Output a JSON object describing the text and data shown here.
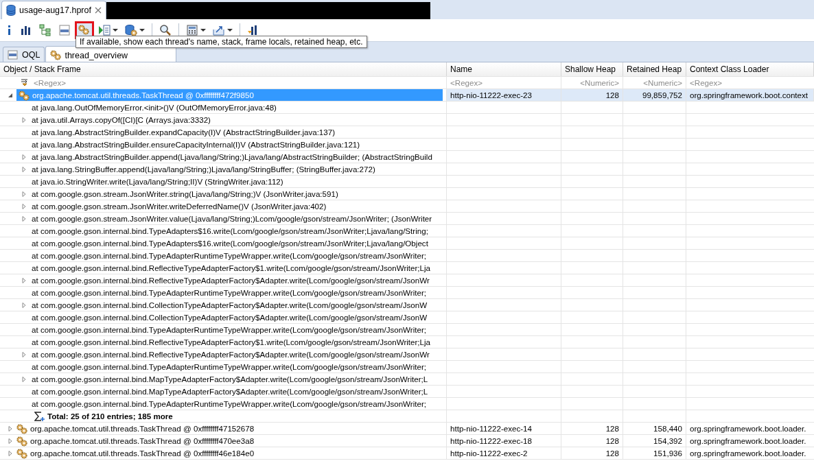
{
  "editor_tab": {
    "title": "usage-aug17.hprof",
    "selected": true
  },
  "toolbar": [
    {
      "pressed": false,
      "dropdown": false
    },
    {
      "pressed": false,
      "dropdown": false
    },
    {
      "pressed": false,
      "dropdown": false
    },
    {
      "pressed": false,
      "dropdown": false
    },
    {
      "pressed": true,
      "dropdown": false
    },
    {
      "pressed": false,
      "dropdown": true
    },
    {
      "pressed": false,
      "dropdown": true
    },
    {
      "pressed": false,
      "dropdown": false
    },
    {
      "pressed": false,
      "dropdown": true
    },
    {
      "pressed": false,
      "dropdown": true
    },
    {
      "pressed": false,
      "dropdown": false
    }
  ],
  "tooltip": "If available, show each thread's name, stack, frame locals, retained heap, etc.",
  "tabs": [
    {
      "label": "OQL",
      "selected": false
    },
    {
      "label": "thread_overview",
      "selected": true
    }
  ],
  "table": {
    "columns": [
      "Object / Stack Frame",
      "Name",
      "Shallow Heap",
      "Retained Heap",
      "Context Class Loader"
    ],
    "filters": [
      "<Regex>",
      "<Regex>",
      "<Numeric>",
      "<Numeric>",
      "<Regex>"
    ],
    "rows": [
      {
        "object": "org.apache.tomcat.util.threads.TaskThread @ 0xffffffff472f9850",
        "name": "http-nio-11222-exec-23",
        "shallow_heap": "128",
        "retained_heap": "99,859,752",
        "class_loader": "org.springframework.boot.context",
        "expanded": true,
        "selected": true,
        "children": [
          {
            "kind": "frame",
            "text": "at java.lang.OutOfMemoryError.<init>()V (OutOfMemoryError.java:48)",
            "expandable": false
          },
          {
            "kind": "frame",
            "text": "at java.util.Arrays.copyOf([CI)[C (Arrays.java:3332)",
            "expandable": true
          },
          {
            "kind": "frame",
            "text": "at java.lang.AbstractStringBuilder.expandCapacity(I)V (AbstractStringBuilder.java:137)",
            "expandable": false
          },
          {
            "kind": "frame",
            "text": "at java.lang.AbstractStringBuilder.ensureCapacityInternal(I)V (AbstractStringBuilder.java:121)",
            "expandable": false
          },
          {
            "kind": "frame",
            "text": "at java.lang.AbstractStringBuilder.append(Ljava/lang/String;)Ljava/lang/AbstractStringBuilder; (AbstractStringBuild",
            "expandable": true
          },
          {
            "kind": "frame",
            "text": "at java.lang.StringBuffer.append(Ljava/lang/String;)Ljava/lang/StringBuffer; (StringBuffer.java:272)",
            "expandable": true
          },
          {
            "kind": "frame",
            "text": "at java.io.StringWriter.write(Ljava/lang/String;II)V (StringWriter.java:112)",
            "expandable": false
          },
          {
            "kind": "frame",
            "text": "at com.google.gson.stream.JsonWriter.string(Ljava/lang/String;)V (JsonWriter.java:591)",
            "expandable": true
          },
          {
            "kind": "frame",
            "text": "at com.google.gson.stream.JsonWriter.writeDeferredName()V (JsonWriter.java:402)",
            "expandable": true
          },
          {
            "kind": "frame",
            "text": "at com.google.gson.stream.JsonWriter.value(Ljava/lang/String;)Lcom/google/gson/stream/JsonWriter; (JsonWriter",
            "expandable": true
          },
          {
            "kind": "frame",
            "text": "at com.google.gson.internal.bind.TypeAdapters$16.write(Lcom/google/gson/stream/JsonWriter;Ljava/lang/String;",
            "expandable": false
          },
          {
            "kind": "frame",
            "text": "at com.google.gson.internal.bind.TypeAdapters$16.write(Lcom/google/gson/stream/JsonWriter;Ljava/lang/Object",
            "expandable": false
          },
          {
            "kind": "frame",
            "text": "at com.google.gson.internal.bind.TypeAdapterRuntimeTypeWrapper.write(Lcom/google/gson/stream/JsonWriter;",
            "expandable": false
          },
          {
            "kind": "frame",
            "text": "at com.google.gson.internal.bind.ReflectiveTypeAdapterFactory$1.write(Lcom/google/gson/stream/JsonWriter;Lja",
            "expandable": false
          },
          {
            "kind": "frame",
            "text": "at com.google.gson.internal.bind.ReflectiveTypeAdapterFactory$Adapter.write(Lcom/google/gson/stream/JsonWr",
            "expandable": true
          },
          {
            "kind": "frame",
            "text": "at com.google.gson.internal.bind.TypeAdapterRuntimeTypeWrapper.write(Lcom/google/gson/stream/JsonWriter;",
            "expandable": false
          },
          {
            "kind": "frame",
            "text": "at com.google.gson.internal.bind.CollectionTypeAdapterFactory$Adapter.write(Lcom/google/gson/stream/JsonW",
            "expandable": true
          },
          {
            "kind": "frame",
            "text": "at com.google.gson.internal.bind.CollectionTypeAdapterFactory$Adapter.write(Lcom/google/gson/stream/JsonW",
            "expandable": false
          },
          {
            "kind": "frame",
            "text": "at com.google.gson.internal.bind.TypeAdapterRuntimeTypeWrapper.write(Lcom/google/gson/stream/JsonWriter;",
            "expandable": false
          },
          {
            "kind": "frame",
            "text": "at com.google.gson.internal.bind.ReflectiveTypeAdapterFactory$1.write(Lcom/google/gson/stream/JsonWriter;Lja",
            "expandable": false
          },
          {
            "kind": "frame",
            "text": "at com.google.gson.internal.bind.ReflectiveTypeAdapterFactory$Adapter.write(Lcom/google/gson/stream/JsonWr",
            "expandable": true
          },
          {
            "kind": "frame",
            "text": "at com.google.gson.internal.bind.TypeAdapterRuntimeTypeWrapper.write(Lcom/google/gson/stream/JsonWriter;",
            "expandable": false
          },
          {
            "kind": "frame",
            "text": "at com.google.gson.internal.bind.MapTypeAdapterFactory$Adapter.write(Lcom/google/gson/stream/JsonWriter;L",
            "expandable": true
          },
          {
            "kind": "frame",
            "text": "at com.google.gson.internal.bind.MapTypeAdapterFactory$Adapter.write(Lcom/google/gson/stream/JsonWriter;L",
            "expandable": false
          },
          {
            "kind": "frame",
            "text": "at com.google.gson.internal.bind.TypeAdapterRuntimeTypeWrapper.write(Lcom/google/gson/stream/JsonWriter;",
            "expandable": false
          },
          {
            "kind": "total",
            "text": "Total: 25 of 210 entries; 185 more"
          }
        ]
      },
      {
        "object": "org.apache.tomcat.util.threads.TaskThread @ 0xffffffff47152678",
        "name": "http-nio-11222-exec-14",
        "shallow_heap": "128",
        "retained_heap": "158,440",
        "class_loader": "org.springframework.boot.loader.",
        "expanded": false,
        "selected": false
      },
      {
        "object": "org.apache.tomcat.util.threads.TaskThread @ 0xffffffff470ee3a8",
        "name": "http-nio-11222-exec-18",
        "shallow_heap": "128",
        "retained_heap": "154,392",
        "class_loader": "org.springframework.boot.loader.",
        "expanded": false,
        "selected": false
      },
      {
        "object": "org.apache.tomcat.util.threads.TaskThread @ 0xffffffff46e184e0",
        "name": "http-nio-11222-exec-2",
        "shallow_heap": "128",
        "retained_heap": "151,936",
        "class_loader": "org.springframework.boot.loader.",
        "expanded": false,
        "selected": false
      }
    ]
  }
}
